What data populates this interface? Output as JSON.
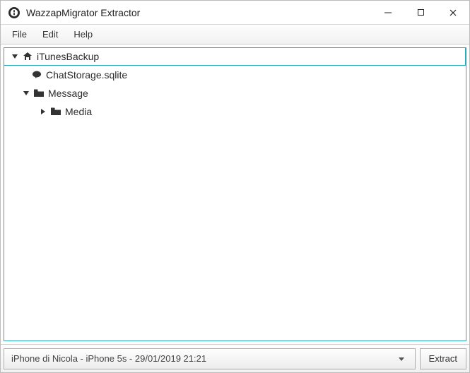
{
  "window": {
    "title": "WazzapMigrator Extractor"
  },
  "menu": {
    "file": "File",
    "edit": "Edit",
    "help": "Help"
  },
  "tree": {
    "root": {
      "label": "iTunesBackup",
      "expanded": true
    },
    "chatstorage": {
      "label": "ChatStorage.sqlite"
    },
    "message": {
      "label": "Message",
      "expanded": true
    },
    "media": {
      "label": "Media",
      "expanded": false
    }
  },
  "footer": {
    "device_label": "iPhone di Nicola - iPhone 5s - 29/01/2019 21:21",
    "extract_label": "Extract"
  }
}
